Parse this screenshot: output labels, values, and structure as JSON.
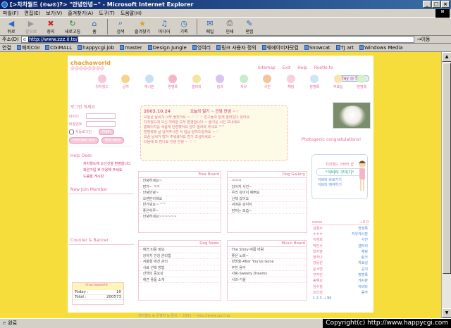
{
  "window": {
    "title": "[>차차월드 (⊙ω⊙)?> \"안녕안녕~\" - Microsoft Internet Explorer",
    "controls": [
      "_",
      "□",
      "×"
    ]
  },
  "menu": [
    "파일(F)",
    "편집(E)",
    "보기(V)",
    "즐겨찾기(A)",
    "도구(T)",
    "도움말(H)"
  ],
  "toolbar": [
    {
      "label": "뒤로",
      "icon": "back-arrow-icon"
    },
    {
      "label": "앞으로",
      "icon": "forward-arrow-icon"
    },
    {
      "label": "중지",
      "icon": "stop-icon"
    },
    {
      "label": "새로고침",
      "icon": "refresh-icon"
    },
    {
      "label": "홈",
      "icon": "home-icon"
    },
    {
      "label": "검색",
      "icon": "search-icon"
    },
    {
      "label": "즐겨찾기",
      "icon": "favorites-icon"
    },
    {
      "label": "미디어",
      "icon": "media-icon"
    },
    {
      "label": "기록",
      "icon": "history-icon"
    },
    {
      "label": "메일",
      "icon": "mail-icon"
    },
    {
      "label": "인쇄",
      "icon": "print-icon"
    },
    {
      "label": "편집",
      "icon": "edit-icon"
    }
  ],
  "address": {
    "label": "주소(D)",
    "url": "http://www.zzz.ii.to/",
    "go": "이동"
  },
  "links": {
    "label": "연결",
    "items": [
      "해피CGI",
      "CGIMALL",
      "happycgi.job",
      "master",
      "Design Jungle",
      "엉여리",
      "링크 사용자 정의",
      "웨에이미자닷컴",
      "Snowcat",
      "TJ art",
      "Windows Media"
    ]
  },
  "site": {
    "logo": "chachaworld",
    "logo_sub": "@@@@@@@@",
    "topnav": [
      "Sitemap",
      "Exit",
      "Help",
      "Rootle to"
    ],
    "stop_button": "Play ◎ Stop",
    "nav": [
      "차차월드",
      "공지",
      "게시판",
      "방명록",
      "갤러리",
      "링크",
      "자유",
      "사진",
      "채팅",
      "방명록",
      "자료실",
      "방명록"
    ],
    "login": {
      "title": "로그인 하세요",
      "id_label": "아이디",
      "pw_label": "비밀번호",
      "remember": "자동로그인",
      "login_button": "login",
      "join_button": "member join",
      "find_button": "find pass"
    },
    "help_desk": {
      "title": "Help Desk",
      "items": [
        "차차월드에 오신것을 환영합니다",
        "회원가입 후 이용해 주세요",
        "도움말 게시판"
      ]
    },
    "new_member": {
      "title": "New Join Member"
    },
    "counter": {
      "title": "Counter & Banner",
      "today_label": "Today :",
      "today": "10",
      "total_label": "Total :",
      "total": "200573"
    },
    "memo": {
      "date": "2003.10.24",
      "title": "오늘의 일기 ~ 안녕 안녕 ~♡",
      "lines": [
        "오늘은 날씨가 너무 좋았어요 ~ ♡ ♡ ♡ 친구들과 함께 놀러갔다 왔어요",
        "차차월드에 오신 여러분 모두 환영합니다 ~ 즐거운 시간 보내세요",
        "홈페이지를 새롭게 단장했어요 많이 놀러와 주세요 ^^",
        "방명록에 글 남겨주시면 꼭 답글 달아드릴게요 ~ ♡",
        "요즘 날씨가 많이 추워졌어요 감기 조심하세요 ~",
        "다음에 또 만나요 안녕 안녕 ~ ♡ ♡"
      ]
    },
    "photo_caption": "Photogenic congratulations!",
    "free_board": {
      "title": "Free Board",
      "items": [
        "안녕하세요~",
        "방가~ ㅋㅋ",
        "안녕안녕~",
        "오랜만이에요",
        "반가워요~ ^^",
        "좋은하루~",
        "안녕하세요~~~~~~"
      ]
    },
    "dog_gallery": {
      "title": "Dog Gallery",
      "items": [
        "ㅋㅋㅋ",
        "강아지 사진~",
        "우리 강아지 예뻐요",
        "산책 갔어요",
        "귀여운 강아지",
        "잠자는 모습~"
      ]
    },
    "dog_news": {
      "title": "Dog News",
      "items": [
        "애견 미용 정보",
        "강아지 건강 관리법",
        "겨울철 애견 관리",
        "사료 선택 방법",
        "산책의 중요성",
        "애견 용품 소개"
      ]
    },
    "music_board": {
      "title": "Music Board",
      "items": [
        "The Story-여름 바람",
        "좋은 노래~",
        "빗방울-After You've Gone",
        "추천 음악",
        "사랑-Sweety Dreams",
        "사과-가을"
      ]
    },
    "doll": {
      "title": "차차월드 아바타 샵",
      "subtitle": "\"아바타 꾸미기\"",
      "links": [
        "아바타 바로가기",
        "아바타 예약하기"
      ]
    },
    "namelist": {
      "header_left": "name",
      "header_right": "→ 0 0",
      "rows": [
        [
          "김철수",
          "방명록"
        ],
        [
          "ㅎㅎㅎ",
          "자유게시판"
        ],
        [
          "이영희",
          "사진"
        ],
        [
          "박민수",
          "갤러리"
        ],
        [
          "최지영",
          "채팅"
        ],
        [
          "정하나",
          "링크"
        ],
        [
          "강동원",
          "자료실"
        ],
        [
          "윤서연",
          "공지"
        ],
        [
          "한지민",
          "방명록"
        ],
        [
          "송혜교",
          "게시판"
        ],
        [
          "임수정",
          "아바타"
        ],
        [
          "조인성",
          "음악"
        ]
      ],
      "pagination": "1 2 3 → 99"
    },
    "footer": "차차월드 & 운영자 & 문의 ~ 2001 ~ http://www.zzz.ii.to"
  },
  "status": {
    "text": "완료",
    "copyright": "Copyright(c) http://www.happycgi.com"
  }
}
